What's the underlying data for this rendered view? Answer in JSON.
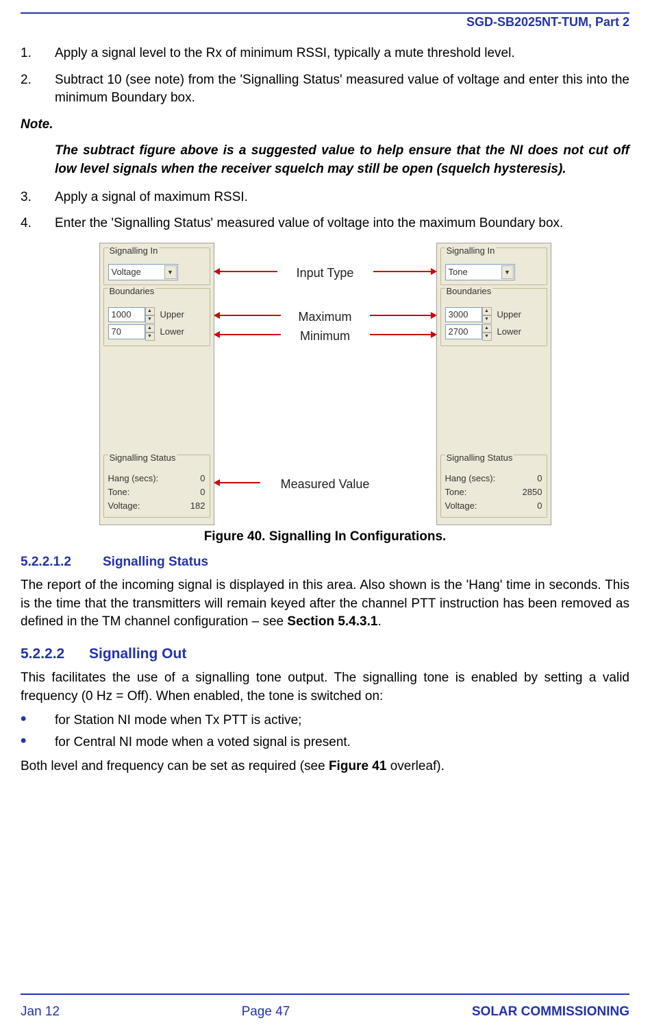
{
  "header": {
    "doc_id": "SGD-SB2025NT-TUM, Part 2"
  },
  "steps": {
    "s1": {
      "num": "1.",
      "text": "Apply a signal level to the Rx of minimum RSSI, typically a mute threshold level."
    },
    "s2": {
      "num": "2.",
      "text": "Subtract 10 (see note) from the 'Signalling Status' measured value of voltage and enter this into the minimum Boundary box."
    },
    "s3": {
      "num": "3.",
      "text": "Apply a signal of maximum RSSI."
    },
    "s4": {
      "num": "4.",
      "text": "Enter the 'Signalling Status' measured value of voltage into the maximum Boundary box."
    }
  },
  "note": {
    "label": "Note.",
    "body": "The subtract figure above is a suggested value to help ensure that the NI does not cut off low level signals when the receiver squelch may still be open (squelch hysteresis)."
  },
  "figure": {
    "callouts": {
      "input_type": "Input Type",
      "maximum": "Maximum",
      "minimum": "Minimum",
      "measured": "Measured Value"
    },
    "panel_left": {
      "group_signalling": "Signalling In",
      "select": "Voltage",
      "group_boundaries": "Boundaries",
      "upper_val": "1000",
      "upper_lbl": "Upper",
      "lower_val": "70",
      "lower_lbl": "Lower",
      "group_status": "Signalling Status",
      "hang_lbl": "Hang (secs):",
      "hang_val": "0",
      "tone_lbl": "Tone:",
      "tone_val": "0",
      "volt_lbl": "Voltage:",
      "volt_val": "182"
    },
    "panel_right": {
      "group_signalling": "Signalling In",
      "select": "Tone",
      "group_boundaries": "Boundaries",
      "upper_val": "3000",
      "upper_lbl": "Upper",
      "lower_val": "2700",
      "lower_lbl": "Lower",
      "group_status": "Signalling Status",
      "hang_lbl": "Hang (secs):",
      "hang_val": "0",
      "tone_lbl": "Tone:",
      "tone_val": "2850",
      "volt_lbl": "Voltage:",
      "volt_val": "0"
    },
    "caption": "Figure 40.  Signalling In Configurations."
  },
  "sections": {
    "sig_status": {
      "num": "5.2.2.1.2",
      "title": "Signalling Status",
      "para_a": "The report of the incoming signal is displayed in this area.  Also shown is the 'Hang' time in seconds.  This is the time that the transmitters will remain keyed after the channel PTT instruction has been removed as defined in the TM channel configuration – see ",
      "para_b": "Section 5.4.3.1",
      "para_c": "."
    },
    "sig_out": {
      "num": "5.2.2.2",
      "title": "Signalling Out",
      "para": "This facilitates the use of a signalling tone output.  The signalling tone is enabled by setting a valid frequency (0 Hz = Off).  When enabled, the tone is switched on:",
      "bullets": {
        "b1": "for Station NI mode when Tx PTT is active;",
        "b2": "for Central NI mode when a voted signal is present."
      },
      "tail_a": "Both level and frequency can be set as required (see ",
      "tail_b": "Figure 41",
      "tail_c": " overleaf)."
    }
  },
  "footer": {
    "left": "Jan 12",
    "center": "Page 47",
    "right": "SOLAR COMMISSIONING"
  }
}
